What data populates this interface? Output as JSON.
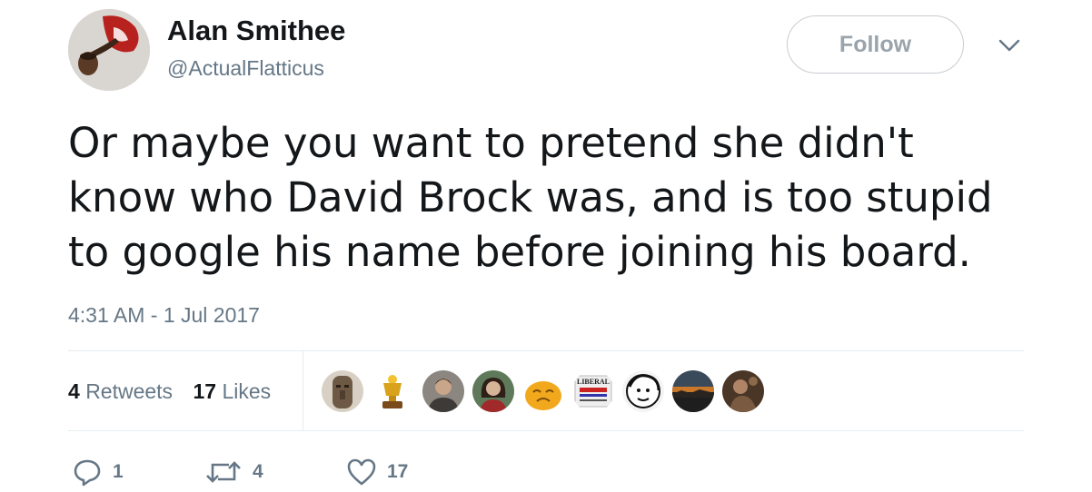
{
  "user": {
    "name": "Alan Smithee",
    "handle": "@ActualFlatticus",
    "avatar_icon": "pipe-smoker-avatar"
  },
  "follow_label": "Follow",
  "menu_icon": "chevron-down-icon",
  "tweet": {
    "lines": [
      "Or maybe you want to pretend she didn't",
      "know who David Brock was, and is too stupid",
      "to google his name before joining his board."
    ],
    "timestamp": "4:31 AM - 1 Jul 2017"
  },
  "stats": {
    "retweets_count": "4",
    "retweets_label": "Retweets",
    "likes_count": "17",
    "likes_label": "Likes"
  },
  "likers": [
    {
      "icon": "statue-avatar",
      "color": "#6e5a44"
    },
    {
      "icon": "trophy-avatar",
      "color": "#c9921a"
    },
    {
      "icon": "man-avatar",
      "color": "#7a6e66"
    },
    {
      "icon": "woman-avatar",
      "color": "#4b3a30"
    },
    {
      "icon": "cartoon-face-avatar",
      "color": "#f2a81c"
    },
    {
      "icon": "liberal-conservative-sign-avatar",
      "color": "#d8d8d8",
      "text": "LIBERAL"
    },
    {
      "icon": "sketch-face-avatar",
      "color": "#eaeaea"
    },
    {
      "icon": "sunset-avatar",
      "color": "#8a5a2a"
    },
    {
      "icon": "painting-avatar",
      "color": "#6a4a33"
    }
  ],
  "actions": {
    "reply_count": "1",
    "retweet_count": "4",
    "like_count": "17"
  }
}
